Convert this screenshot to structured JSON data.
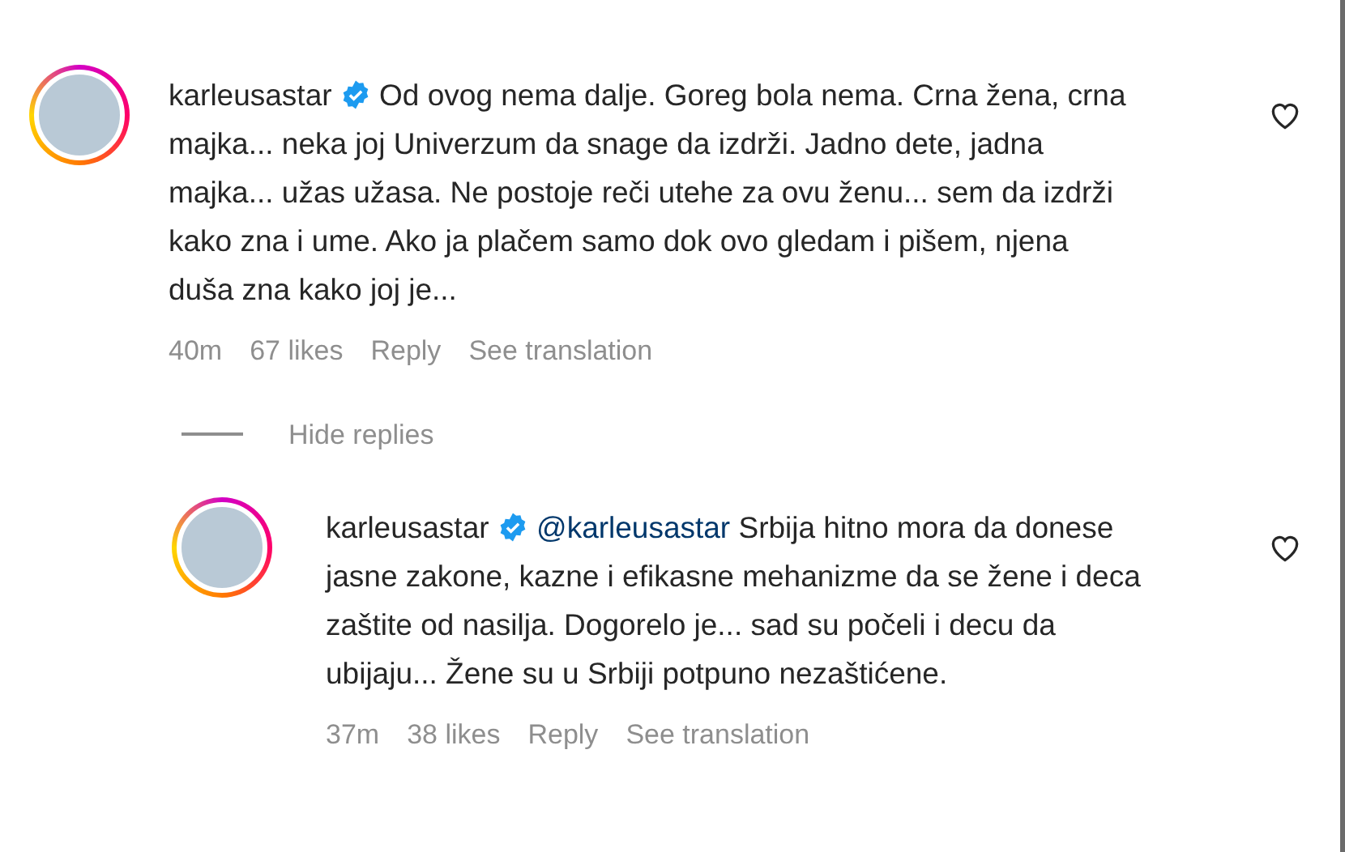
{
  "comments": [
    {
      "username": "karleusastar",
      "verified": true,
      "text": "Od ovog nema dalje. Goreg bola nema. Crna žena, crna majka... neka joj Univerzum da snage da izdrži. Jadno dete, jadna majka... užas užasa. Ne postoje reči utehe za ovu ženu... sem da izdrži kako zna i ume. Ako ja plačem samo dok ovo gledam i pišem, njena duša zna kako joj je...",
      "time": "40m",
      "likes": "67 likes",
      "reply": "Reply",
      "translation": "See translation",
      "toggle": "Hide replies",
      "replies": [
        {
          "username": "karleusastar",
          "verified": true,
          "mention": "@karleusastar",
          "text": "Srbija hitno mora da donese jasne zakone, kazne i efikasne mehanizme da se žene i deca zaštite od nasilja. Dogorelo je... sad su počeli i decu da ubijaju... Žene su u Srbiji potpuno nezaštićene.",
          "time": "37m",
          "likes": "38 likes",
          "reply": "Reply",
          "translation": "See translation"
        }
      ]
    }
  ]
}
